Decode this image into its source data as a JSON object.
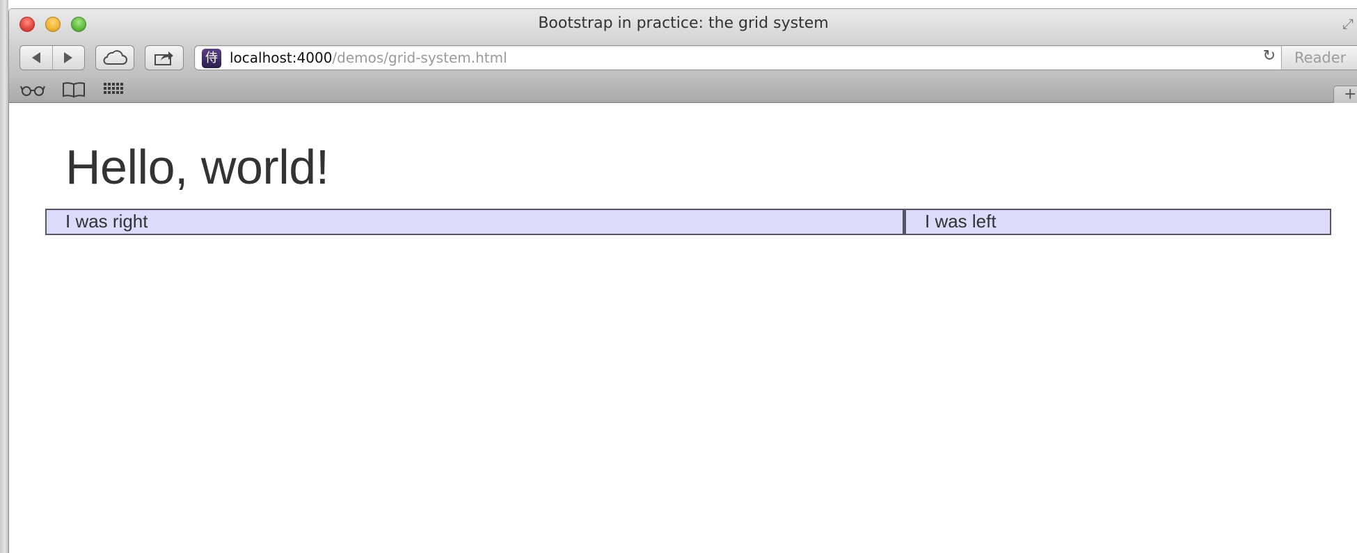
{
  "window": {
    "title": "Bootstrap in practice: the grid system"
  },
  "toolbar": {
    "back_icon": "back-arrow-icon",
    "forward_icon": "forward-arrow-icon",
    "cloud_icon": "icloud-tabs-icon",
    "share_icon": "share-icon",
    "address": {
      "host": "localhost:4000",
      "path": "/demos/grid-system.html",
      "favicon_glyph": "侍"
    },
    "reader_label": "Reader"
  },
  "bookmarks_bar": {
    "icons": [
      "reading-list-icon",
      "bookmarks-icon",
      "top-sites-icon"
    ],
    "new_tab_label": "+"
  },
  "page": {
    "heading": "Hello, world!",
    "grid_row": {
      "columns": [
        {
          "text": "I was right",
          "background": "#dcdcfa"
        },
        {
          "text": "I was left",
          "background": "#dcdcfa"
        }
      ]
    }
  }
}
